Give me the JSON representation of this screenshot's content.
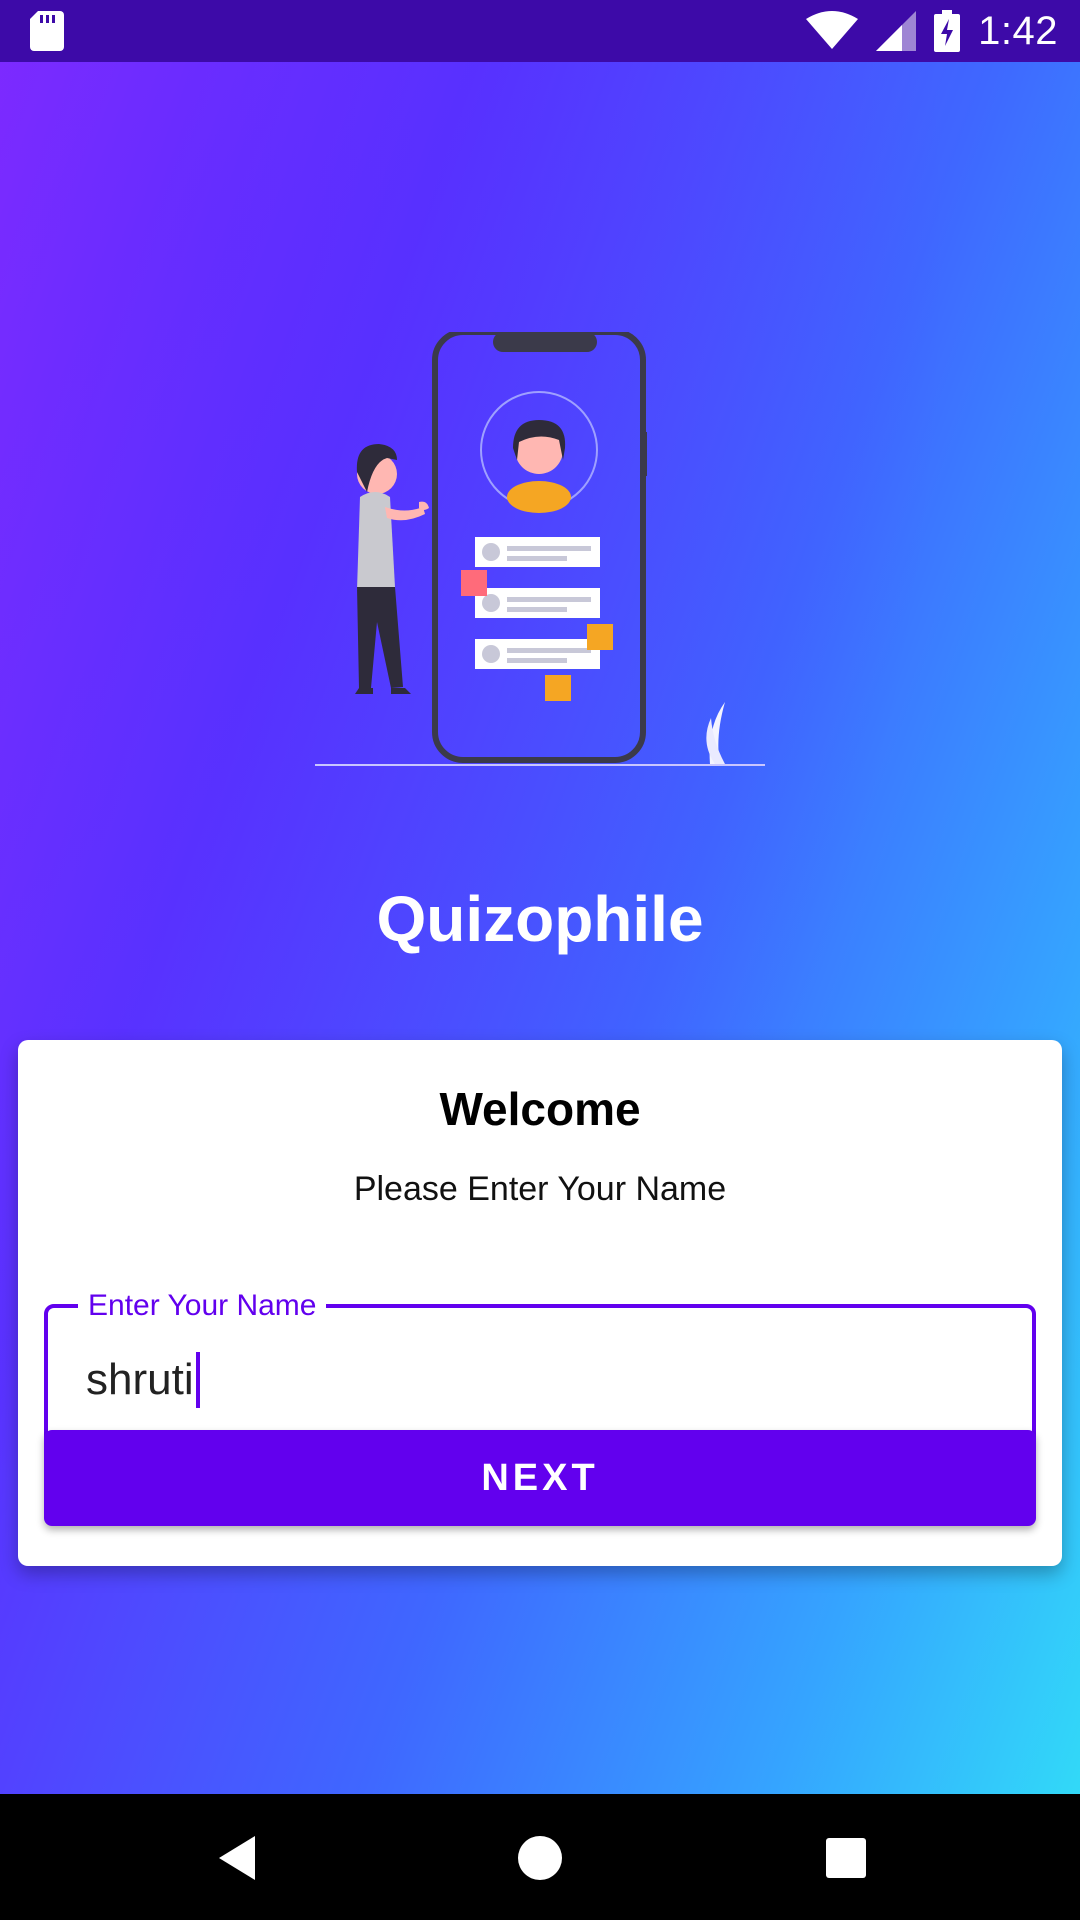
{
  "status_bar": {
    "time": "1:42",
    "icons": [
      "sd-card-icon",
      "wifi-icon",
      "signal-icon",
      "battery-charging-icon"
    ]
  },
  "app": {
    "title": "Quizophile",
    "illustration": "person-with-phone-quiz-illustration"
  },
  "card": {
    "title": "Welcome",
    "subtitle": "Please Enter Your Name",
    "name_input": {
      "label": "Enter Your Name",
      "value": "shruti"
    },
    "next_button_label": "NEXT"
  },
  "nav_bar": {
    "buttons": [
      "back-icon",
      "home-icon",
      "recents-icon"
    ]
  },
  "colors": {
    "accent": "#6200ee",
    "status_bar": "#3d0aa8",
    "gradient_start": "#8a2bff",
    "gradient_end": "#32d9f8"
  }
}
